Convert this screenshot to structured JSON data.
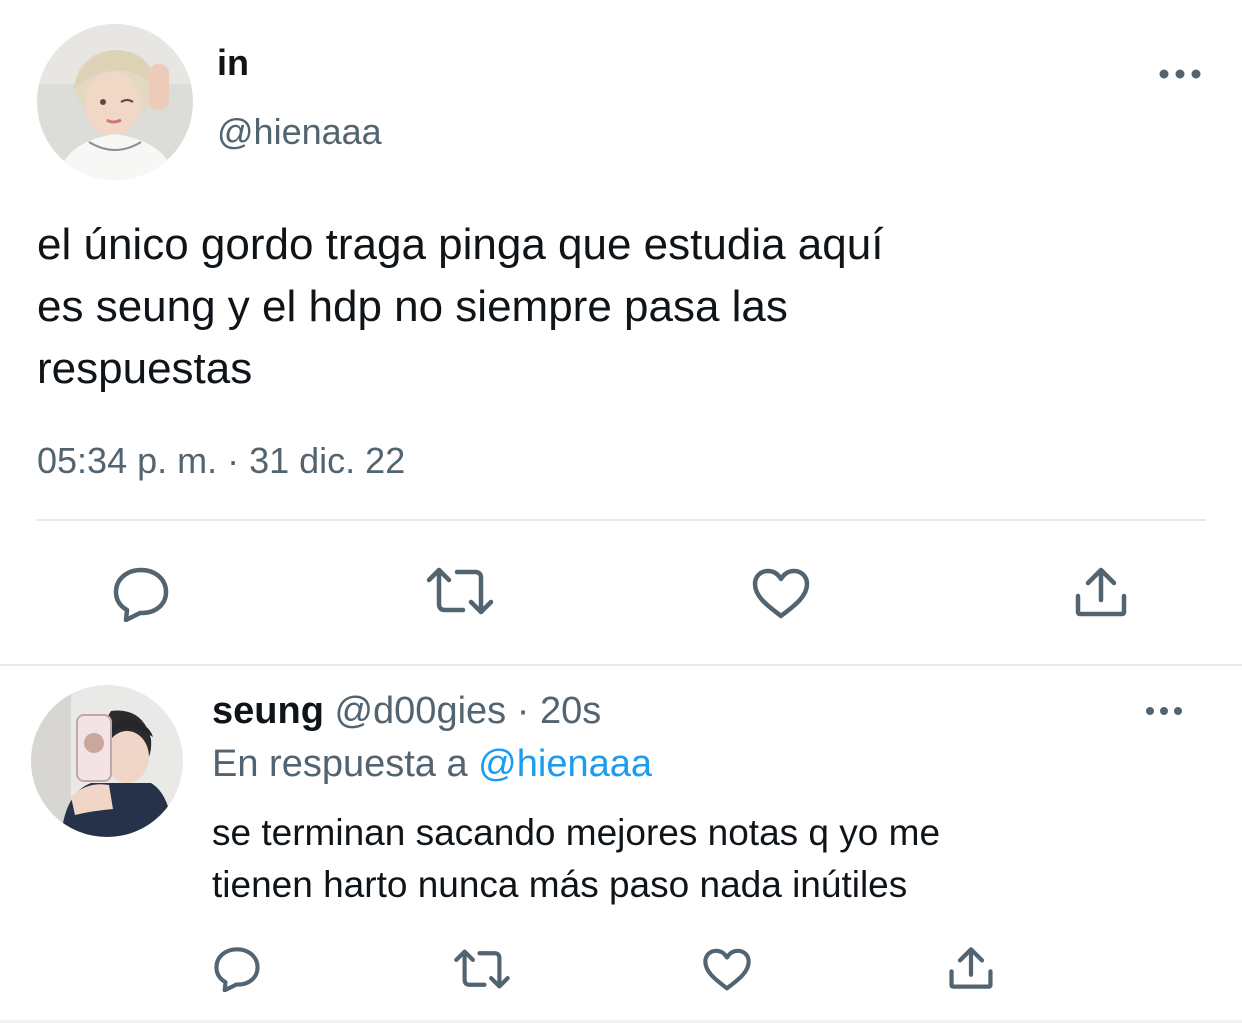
{
  "tweet": {
    "display_name": "in",
    "handle": "@hienaaa",
    "text_lines": [
      "el único gordo traga pinga que estudia aquí",
      "es seung y el hdp no siempre pasa las",
      "respuestas"
    ],
    "timestamp": "05:34 p. m. · 31 dic. 22",
    "avatar_icon": "user-avatar",
    "more_icon": "more-horizontal-icon",
    "actions": [
      "reply-icon",
      "retweet-icon",
      "like-icon",
      "share-icon"
    ]
  },
  "reply": {
    "display_name": "seung",
    "handle": "@d00gies",
    "separator": "·",
    "time": "20s",
    "reply_to_prefix": "En respuesta a",
    "reply_to_handle": "@hienaaa",
    "text_lines": [
      "se terminan sacando mejores notas q yo me",
      "tienen harto nunca más paso nada inútiles"
    ],
    "avatar_icon": "user-avatar",
    "more_icon": "more-horizontal-icon",
    "actions": [
      "reply-icon",
      "retweet-icon",
      "like-icon",
      "share-icon"
    ]
  },
  "colors": {
    "text": "#0f1419",
    "secondary": "#536471",
    "link": "#1d9bf0",
    "divider": "#e6e9ec"
  }
}
